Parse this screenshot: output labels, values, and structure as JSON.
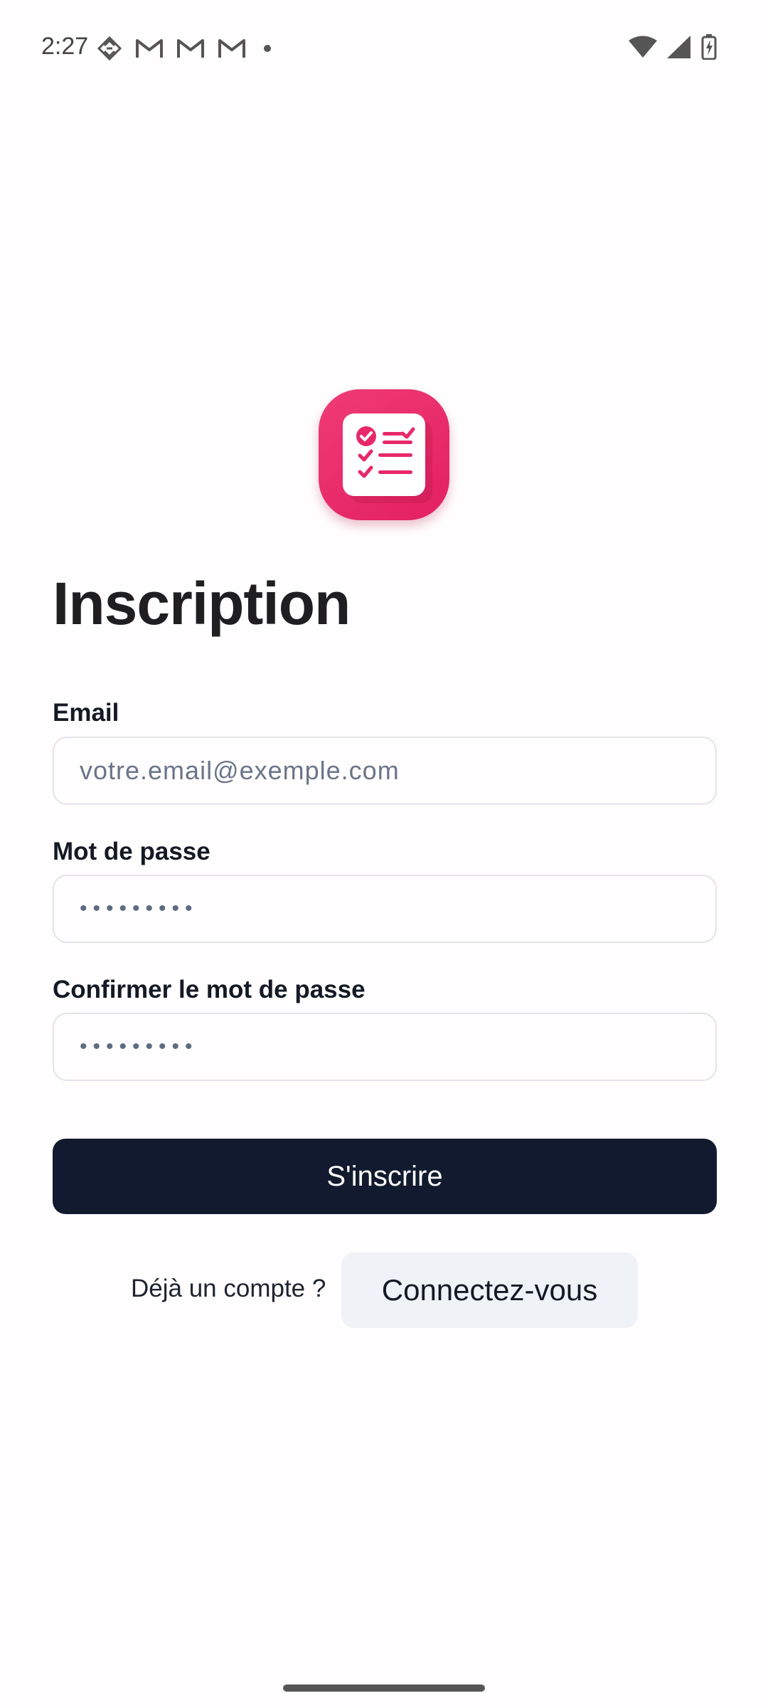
{
  "status_bar": {
    "time": "2:27",
    "left_icons": [
      "debug-icon",
      "gmail-icon",
      "gmail-icon",
      "gmail-icon",
      "dot-icon"
    ],
    "right_icons": [
      "wifi-icon",
      "signal-icon",
      "battery-charging-icon"
    ]
  },
  "app": {
    "icon": "checklist-app-icon",
    "brand_color": "#e8286a"
  },
  "page": {
    "title": "Inscription"
  },
  "form": {
    "email": {
      "label": "Email",
      "placeholder": "votre.email@exemple.com",
      "value": ""
    },
    "password": {
      "label": "Mot de passe",
      "value": "•••••••••"
    },
    "confirm_password": {
      "label": "Confirmer le mot de passe",
      "value": "•••••••••"
    },
    "submit_label": "S'inscrire",
    "submit_color": "#111a2e"
  },
  "login": {
    "prompt": "Déjà un compte ?",
    "link_label": "Connectez-vous"
  }
}
